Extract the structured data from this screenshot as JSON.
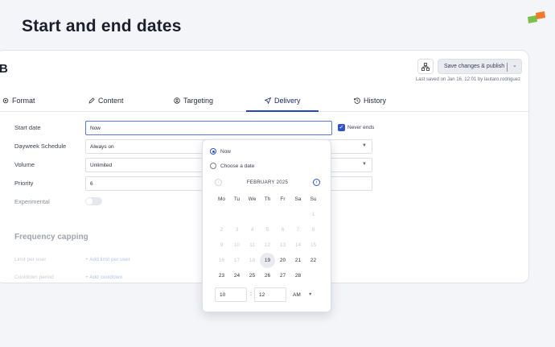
{
  "page": {
    "title": "Start and end dates"
  },
  "card": {
    "letter": "B",
    "save_label": "Save changes & publish",
    "last_saved": "Last saved on Jan 16, 12:01 by lautaro.rodriguez"
  },
  "tabs": [
    {
      "label": "Format",
      "icon": "gear-icon"
    },
    {
      "label": "Content",
      "icon": "pencil-icon"
    },
    {
      "label": "Targeting",
      "icon": "user-icon"
    },
    {
      "label": "Delivery",
      "icon": "send-icon",
      "active": true
    },
    {
      "label": "History",
      "icon": "history-icon"
    }
  ],
  "form": {
    "start_date": {
      "label": "Start date",
      "value": "Now"
    },
    "never_ends": {
      "label": "Never ends",
      "checked": true
    },
    "dayweek": {
      "label": "Dayweek Schedule",
      "value": "Always on"
    },
    "volume": {
      "label": "Volume",
      "value": "Unlimited"
    },
    "priority": {
      "label": "Priority",
      "value": "6"
    },
    "experimental": {
      "label": "Experimental",
      "on": false
    },
    "frequency_title": "Frequency capping",
    "limit_per_user": {
      "label": "Limit per user",
      "action": "+ Add limit per user"
    },
    "cooldown": {
      "label": "Cooldown period",
      "action": "+ Add cooldown"
    }
  },
  "datepicker": {
    "option_now": "Now",
    "option_choose": "Choose a date",
    "selected_option": "now",
    "month_label": "FEBRUARY 2025",
    "weekdays": [
      "Mo",
      "Tu",
      "We",
      "Th",
      "Fr",
      "Sa",
      "Su"
    ],
    "weeks": [
      [
        "",
        "",
        "",
        "",
        "",
        "",
        "1"
      ],
      [
        "2",
        "3",
        "4",
        "5",
        "6",
        "7",
        "8"
      ],
      [
        "9",
        "10",
        "11",
        "12",
        "13",
        "14",
        "15"
      ],
      [
        "16",
        "17",
        "18",
        "19",
        "20",
        "21",
        "22"
      ],
      [
        "23",
        "24",
        "25",
        "26",
        "27",
        "28",
        ""
      ]
    ],
    "today": "19",
    "hour": "10",
    "minute": "12",
    "ampm": "AM"
  },
  "colors": {
    "accent": "#3454c4",
    "logo_orange": "#f07a2a",
    "logo_green": "#7cc04b"
  }
}
